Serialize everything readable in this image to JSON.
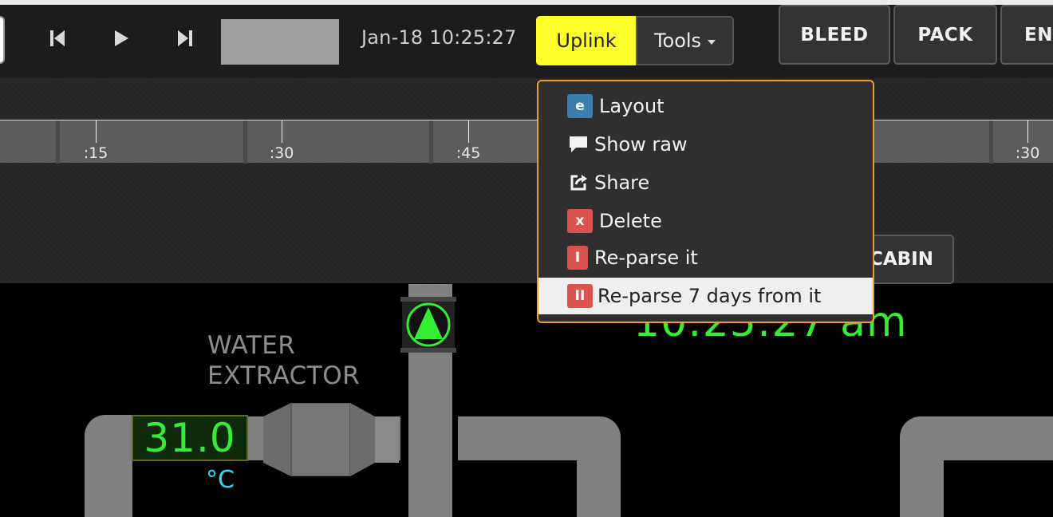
{
  "toolbar": {
    "timestamp": "Jan-18 10:25:27",
    "uplink_label": "Uplink",
    "tools_label": "Tools",
    "system_buttons": {
      "bleed": "BLEED",
      "pack": "PACK",
      "eng": "ENG"
    }
  },
  "timeline": {
    "ticks": [
      ":15",
      ":30",
      ":45",
      ":30"
    ]
  },
  "cabin_label": "CABIN",
  "tools_menu": {
    "items": [
      {
        "label": "Layout",
        "icon": "e",
        "badge_color": "#3b7fb0"
      },
      {
        "label": "Show raw",
        "icon": "speech-bubble-icon"
      },
      {
        "label": "Share",
        "icon": "share-icon"
      },
      {
        "label": "Delete",
        "icon": "x",
        "badge_color": "#d9534f"
      },
      {
        "label": "Re-parse it",
        "icon": "I",
        "badge_color": "#d9534f"
      },
      {
        "label": "Re-parse 7 days from it",
        "icon": "II",
        "badge_color": "#d9534f",
        "highlighted": true
      }
    ]
  },
  "synoptic": {
    "clock": "10:25:27 am",
    "water_extractor_label": [
      "WATER",
      "EXTRACTOR"
    ],
    "temperature_value": "31.0",
    "temperature_unit": "°C"
  },
  "colors": {
    "uplink": "#ffff2a",
    "menu_border": "#f29b2f",
    "digital_green": "#33ee33",
    "unit_cyan": "#2fdcff",
    "pipe_gray": "#808080"
  }
}
